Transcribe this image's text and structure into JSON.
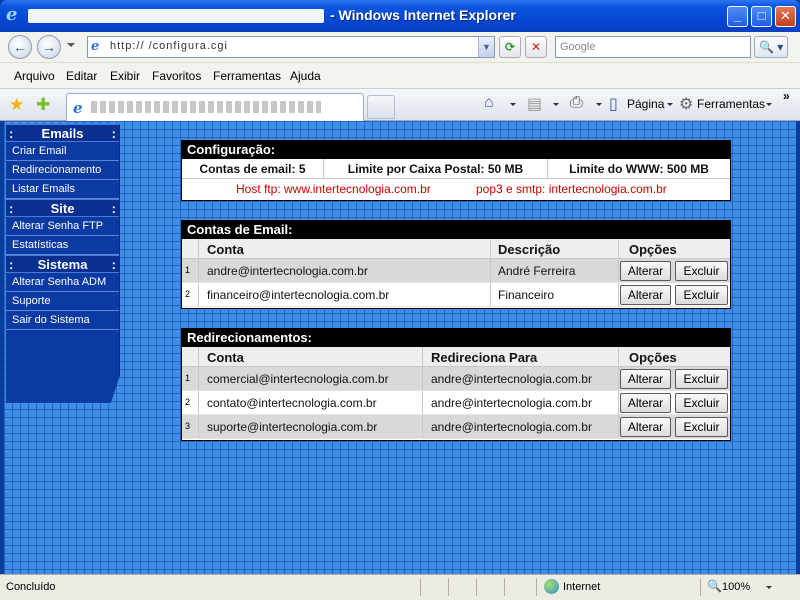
{
  "window": {
    "title": "- Windows Internet Explorer",
    "controls": {
      "minimize": "_",
      "maximize": "□",
      "close": "✕"
    }
  },
  "addressbar": {
    "url": "http://                        /configura.cgi",
    "search_placeholder": "Google",
    "search_button": "🔍"
  },
  "menu": {
    "items": [
      "Arquivo",
      "Editar",
      "Exibir",
      "Favoritos",
      "Ferramentas",
      "Ajuda"
    ]
  },
  "commandbar": {
    "page_label": "Página",
    "tools_label": "Ferramentas",
    "chevron": "»"
  },
  "sidebar": {
    "sections": [
      {
        "title": "Emails",
        "items": [
          "Criar Email",
          "Redirecionamento",
          "Listar Emails"
        ]
      },
      {
        "title": "Site",
        "items": [
          "Alterar Senha FTP",
          "Estatísticas"
        ]
      },
      {
        "title": "Sistema",
        "items": [
          "Alterar Senha ADM",
          "Suporte",
          "Sair do Sistema"
        ]
      }
    ]
  },
  "config": {
    "title": "Configuração:",
    "email_accounts": "Contas de email: 5",
    "mailbox_limit": "Limite por Caixa Postal: 50 MB",
    "www_limit": "Limite do WWW: 500 MB",
    "ftp_host": "Host ftp: www.intertecnologia.com.br",
    "mail_hosts": "pop3 e smtp: intertecnologia.com.br"
  },
  "accounts": {
    "title": "Contas de Email:",
    "headers": {
      "account": "Conta",
      "description": "Descrição",
      "options": "Opções"
    },
    "rows": [
      {
        "idx": "1",
        "account": "andre@intertecnologia.com.br",
        "description": "André Ferreira"
      },
      {
        "idx": "2",
        "account": "financeiro@intertecnologia.com.br",
        "description": "Financeiro"
      }
    ],
    "edit_label": "Alterar",
    "delete_label": "Excluir"
  },
  "redirects": {
    "title": "Redirecionamentos:",
    "headers": {
      "account": "Conta",
      "target": "Redireciona Para",
      "options": "Opções"
    },
    "rows": [
      {
        "idx": "1",
        "account": "comercial@intertecnologia.com.br",
        "target": "andre@intertecnologia.com.br"
      },
      {
        "idx": "2",
        "account": "contato@intertecnologia.com.br",
        "target": "andre@intertecnologia.com.br"
      },
      {
        "idx": "3",
        "account": "suporte@intertecnologia.com.br",
        "target": "andre@intertecnologia.com.br"
      }
    ],
    "edit_label": "Alterar",
    "delete_label": "Excluir"
  },
  "status": {
    "text": "Concluído",
    "zone": "Internet",
    "zoom": "100%"
  }
}
